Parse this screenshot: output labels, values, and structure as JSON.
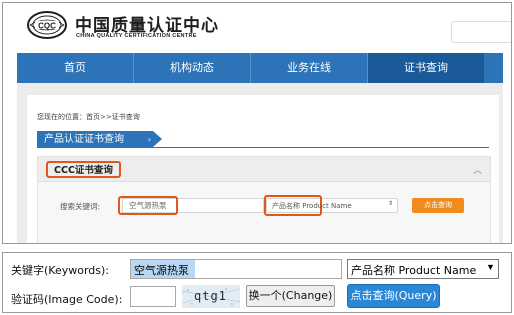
{
  "header": {
    "logo_text": "CQC",
    "org_name_cn": "中国质量认证中心",
    "org_name_en": "CHINA QUALITY CERTIFICATION CENTRE"
  },
  "nav": {
    "items": [
      {
        "label": "首页",
        "active": false
      },
      {
        "label": "机构动态",
        "active": false
      },
      {
        "label": "业务在线",
        "active": false
      },
      {
        "label": "证书查询",
        "active": true
      }
    ]
  },
  "breadcrumb": "您现在的位置：首页>>证书查询",
  "section_title": "产品认证证书查询",
  "ccc_panel": {
    "title": "CCC证书查询",
    "collapse_icon": "chevron-up-icon",
    "search_label": "搜索关键词:",
    "keyword_value": "空气源热泵",
    "type_value": "产品名称 Product Name",
    "query_button": "点击查询"
  },
  "form": {
    "keyword_label": "关键字(Keywords):",
    "keyword_value": "空气源热泵",
    "type_value": "产品名称 Product Name",
    "image_code_label": "验证码(Image Code):",
    "image_code_value": "",
    "captcha_text": "qtg1",
    "change_button": "换一个(Change)",
    "query_button": "点击查询(Query)"
  },
  "colors": {
    "nav_blue": "#2c73b7",
    "nav_active": "#1b5a99",
    "highlight_orange": "#e2571b",
    "query_orange": "#f08c1e",
    "query_blue": "#2a87d6"
  }
}
